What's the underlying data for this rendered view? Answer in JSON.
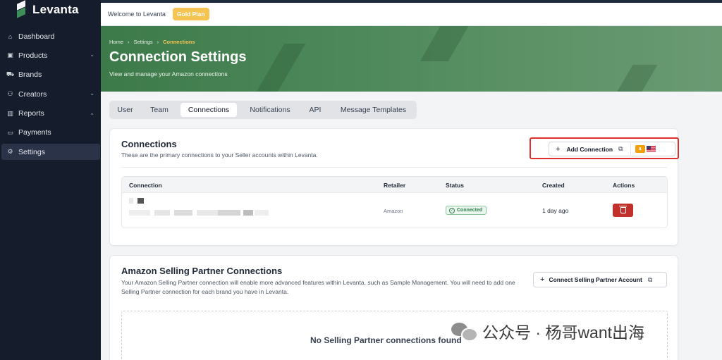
{
  "app": {
    "name": "Levanta"
  },
  "sidebar": {
    "items": [
      {
        "label": "Dashboard",
        "icon": "home-icon",
        "expandable": false
      },
      {
        "label": "Products",
        "icon": "box-icon",
        "expandable": true
      },
      {
        "label": "Brands",
        "icon": "truck-icon",
        "expandable": false
      },
      {
        "label": "Creators",
        "icon": "users-icon",
        "expandable": true
      },
      {
        "label": "Reports",
        "icon": "bar-chart-icon",
        "expandable": true
      },
      {
        "label": "Payments",
        "icon": "credit-card-icon",
        "expandable": false
      },
      {
        "label": "Settings",
        "icon": "gear-icon",
        "expandable": false,
        "active": true
      }
    ]
  },
  "topbar": {
    "welcome": "Welcome to Levanta",
    "plan": "Gold Plan"
  },
  "hero": {
    "breadcrumb": [
      "Home",
      "Settings",
      "Connections"
    ],
    "title": "Connection Settings",
    "subtitle": "View and manage your Amazon connections"
  },
  "tabs": [
    {
      "label": "User"
    },
    {
      "label": "Team"
    },
    {
      "label": "Connections",
      "active": true
    },
    {
      "label": "Notifications"
    },
    {
      "label": "API"
    },
    {
      "label": "Message Templates"
    }
  ],
  "connections": {
    "title": "Connections",
    "subtitle": "These are the primary connections to your Seller accounts within Levanta.",
    "add_button": "Add Connection",
    "add_badge": "a",
    "columns": [
      "Connection",
      "Retailer",
      "Status",
      "Created",
      "Actions"
    ],
    "rows": [
      {
        "retailer": "Amazon",
        "status": "Connected",
        "created": "1 day ago"
      }
    ]
  },
  "selling_partner": {
    "title": "Amazon Selling Partner Connections",
    "description": "Your Amazon Selling Partner connection will enable more advanced features within Levanta, such as Sample Management. You will need to add one Selling Partner connection for each brand you have in Levanta.",
    "connect_button": "Connect Selling Partner Account",
    "empty": "No Selling Partner connections found"
  },
  "watermark": {
    "text": "公众号 · 杨哥want出海"
  },
  "colors": {
    "sidebar": "#151c2c",
    "accent": "#f6c453",
    "hero": "#4f8a5c",
    "danger": "#c2302c",
    "highlight": "#e0302b"
  }
}
